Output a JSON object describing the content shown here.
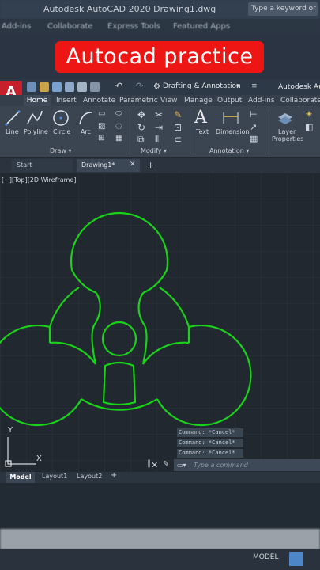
{
  "window": {
    "title": "Autodesk AutoCAD 2020    Drawing1.dwg",
    "search_placeholder": "Type a keyword or phrase"
  },
  "menu_bar": [
    "Add-ins",
    "Collaborate",
    "Express Tools",
    "Featured Apps"
  ],
  "banner": {
    "text": "Autocad practice",
    "color": "#ee1515"
  },
  "app_logo": {
    "letter": "A"
  },
  "quick_access": {
    "workspace": "Drafting & Annotation",
    "right_title": "Autodesk Auto"
  },
  "ribbon_tabs": [
    "Home",
    "Insert",
    "Annotate",
    "Parametric",
    "View",
    "Manage",
    "Output",
    "Add-ins",
    "Collaborate"
  ],
  "ribbon": {
    "draw_tools": [
      "Line",
      "Polyline",
      "Circle",
      "Arc"
    ],
    "panels": {
      "draw": "Draw ▾",
      "modify": "Modify ▾",
      "annotation": "Annotation ▾"
    },
    "annotation_tools": [
      "Text",
      "Dimension"
    ],
    "layer_tool": [
      "Layer",
      "Properties"
    ]
  },
  "doc_tabs": {
    "start": "Start",
    "drawing": "Drawing1*",
    "close": "✕",
    "add": "+"
  },
  "viewport_label": "[−][Top][2D Wireframe]",
  "ucs": {
    "x_label": "X",
    "y_label": "Y"
  },
  "drawing": {
    "line_color": "#19d219",
    "icon": "biohazard-symbol"
  },
  "command_history": [
    "Command: *Cancel*",
    "Command: *Cancel*",
    "Command: *Cancel*"
  ],
  "command_input": {
    "placeholder": "Type a command",
    "close": "✕",
    "wrench": "✎"
  },
  "layout_tabs": [
    "Model",
    "Layout1",
    "Layout2",
    "+"
  ],
  "status_bar": {
    "mode": "MODEL"
  }
}
